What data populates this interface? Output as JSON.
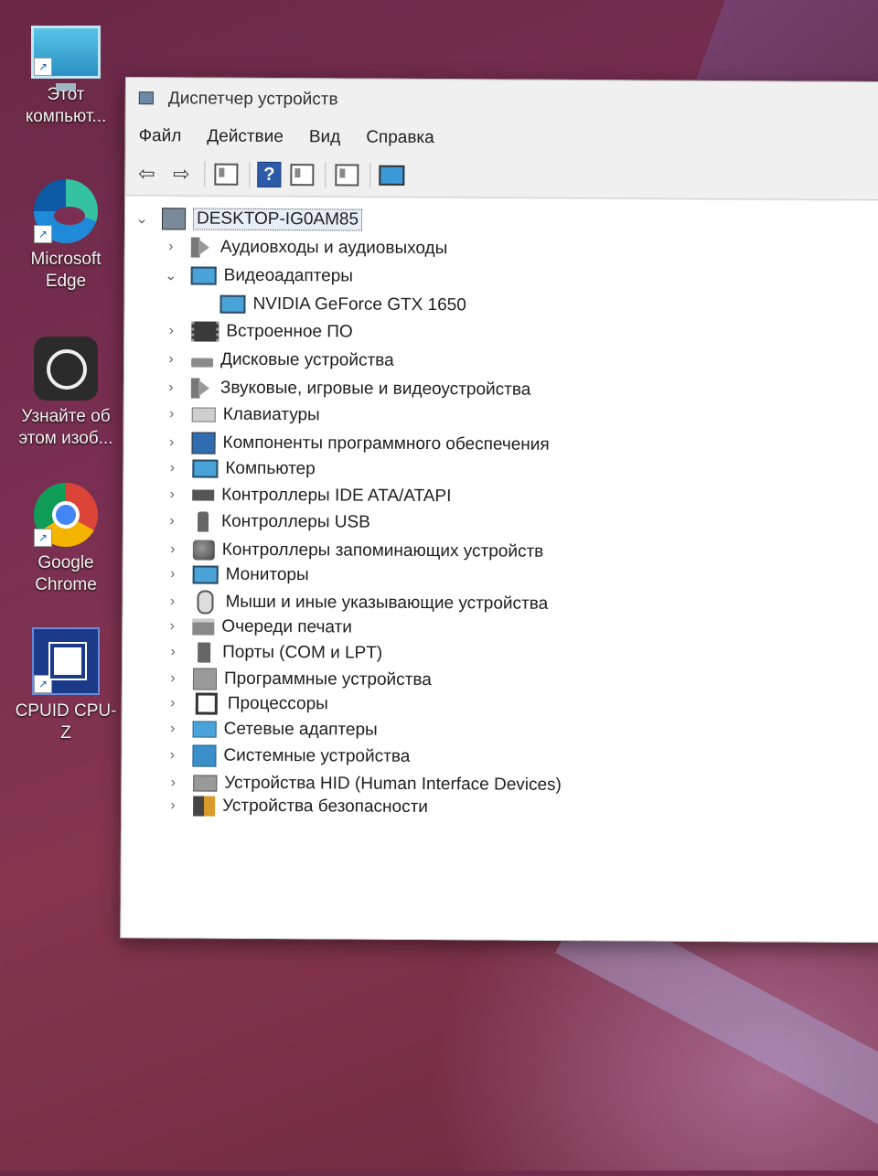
{
  "desktop": {
    "icons": [
      {
        "label": "Этот компьют...",
        "icon": "this-pc-icon"
      },
      {
        "label": "Microsoft Edge",
        "icon": "edge-icon"
      },
      {
        "label": "Узнайте об этом изоб...",
        "icon": "camera-icon"
      },
      {
        "label": "Google Chrome",
        "icon": "chrome-icon"
      },
      {
        "label": "CPUID CPU-Z",
        "icon": "cpuz-icon"
      }
    ]
  },
  "window": {
    "title": "Диспетчер устройств",
    "menu": [
      "Файл",
      "Действие",
      "Вид",
      "Справка"
    ],
    "toolbar": {
      "back": "⇦",
      "forward": "⇨",
      "help": "?"
    }
  },
  "tree": {
    "root": "DESKTOP-IG0AM85",
    "categories": [
      {
        "label": "Аудиовходы и аудиовыходы",
        "expanded": false
      },
      {
        "label": "Видеоадаптеры",
        "expanded": true,
        "children": [
          "NVIDIA GeForce GTX 1650"
        ]
      },
      {
        "label": "Встроенное ПО",
        "expanded": false
      },
      {
        "label": "Дисковые устройства",
        "expanded": false
      },
      {
        "label": "Звуковые, игровые и видеоустройства",
        "expanded": false
      },
      {
        "label": "Клавиатуры",
        "expanded": false
      },
      {
        "label": "Компоненты программного обеспечения",
        "expanded": false
      },
      {
        "label": "Компьютер",
        "expanded": false
      },
      {
        "label": "Контроллеры IDE ATA/ATAPI",
        "expanded": false
      },
      {
        "label": "Контроллеры USB",
        "expanded": false
      },
      {
        "label": "Контроллеры запоминающих устройств",
        "expanded": false
      },
      {
        "label": "Мониторы",
        "expanded": false
      },
      {
        "label": "Мыши и иные указывающие устройства",
        "expanded": false
      },
      {
        "label": "Очереди печати",
        "expanded": false
      },
      {
        "label": "Порты (COM и LPT)",
        "expanded": false
      },
      {
        "label": "Программные устройства",
        "expanded": false
      },
      {
        "label": "Процессоры",
        "expanded": false
      },
      {
        "label": "Сетевые адаптеры",
        "expanded": false
      },
      {
        "label": "Системные устройства",
        "expanded": false
      },
      {
        "label": "Устройства HID (Human Interface Devices)",
        "expanded": false
      },
      {
        "label": "Устройства безопасности",
        "expanded": false
      }
    ]
  },
  "glyphs": {
    "collapsed": "›",
    "expanded": "⌄",
    "shortcut": "↗"
  }
}
